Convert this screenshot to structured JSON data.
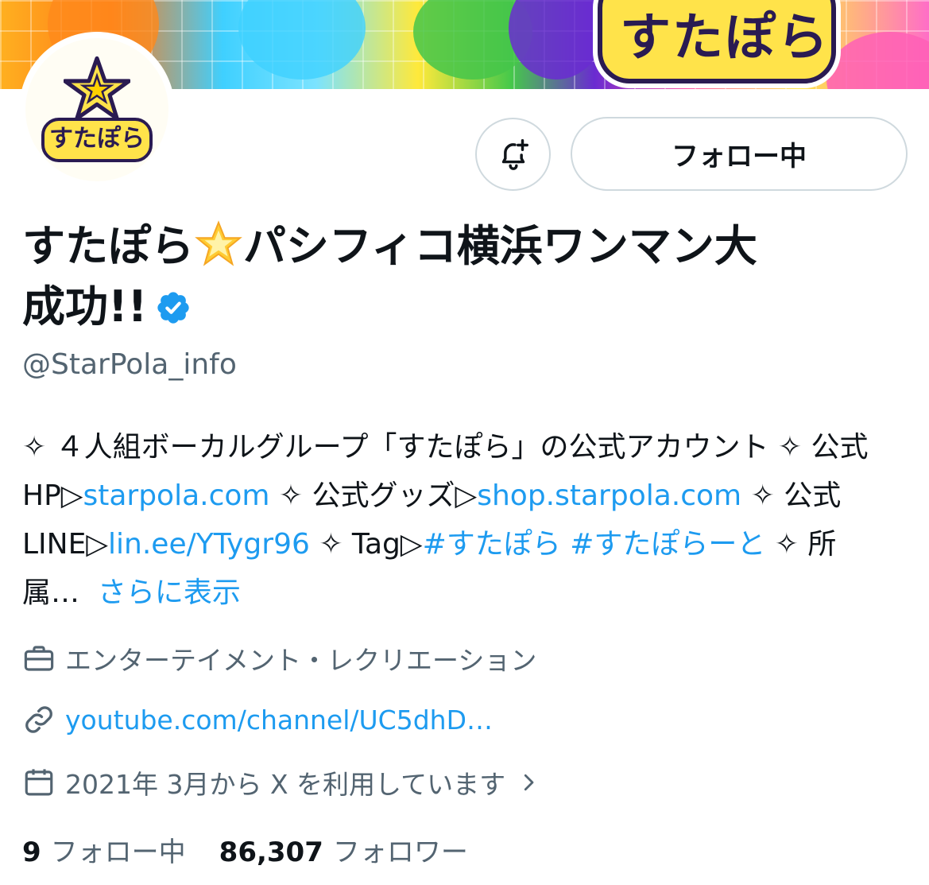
{
  "profile": {
    "display_name": "すたぽら🌟パシフィコ横浜ワンマン大成功!!",
    "name_part1": "すたぽら",
    "name_part2": "パシフィコ横浜ワンマン大",
    "name_part3": "成功!!",
    "handle": "@StarPola_info",
    "banner_logo_text": "すたぽら",
    "avatar_text": "すたぽら"
  },
  "actions": {
    "notify_icon": "bell-plus-icon",
    "follow_label": "フォロー中"
  },
  "bio": {
    "seg1": "✧ ４人組ボーカルグループ「すたぽら」の公式アカウント ✧ 公式HP▷",
    "link1": "starpola.com",
    "seg2": " ✧ 公式グッズ▷",
    "link2": "shop.starpola.com",
    "seg3": " ✧ 公式LINE▷",
    "link3": "lin.ee/YTygr96",
    "seg4": " ✧ Tag▷",
    "hashtag1": "#すたぽら",
    "hashtag2": "#すたぽらーと",
    "seg5": " ✧ 所属…",
    "show_more": "さらに表示"
  },
  "meta": {
    "category": "エンターテイメント・レクリエーション",
    "url": "youtube.com/channel/UC5dhD…",
    "joined": "2021年 3月から X を利用しています"
  },
  "stats": {
    "following_count": "9",
    "following_label": "フォロー中",
    "followers_count": "86,307",
    "followers_label": "フォロワー"
  },
  "colors": {
    "link": "#1d9bf0",
    "secondary_text": "#536471",
    "primary_text": "#0f1419",
    "border": "#cfd9de",
    "verified": "#1d9bf0"
  }
}
